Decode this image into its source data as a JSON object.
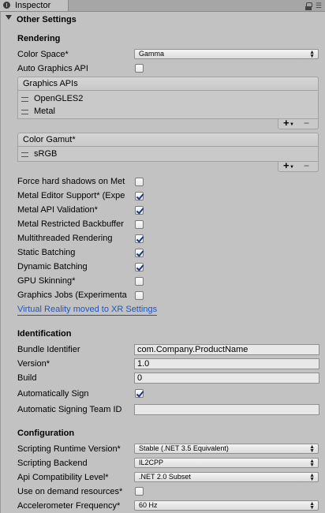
{
  "window": {
    "tab_title": "Inspector",
    "lock_icon": "lock-icon",
    "menu_icon": "menu-icon"
  },
  "foldout": {
    "title": "Other Settings"
  },
  "rendering": {
    "section_title": "Rendering",
    "color_space_label": "Color Space*",
    "color_space_value": "Gamma",
    "auto_graphics_api_label": "Auto Graphics API",
    "auto_graphics_api_checked": false,
    "graphics_apis": {
      "title": "Graphics APIs",
      "items": [
        "OpenGLES2",
        "Metal"
      ],
      "add_label": "+",
      "remove_label": "−"
    },
    "color_gamut": {
      "title": "Color Gamut*",
      "items": [
        "sRGB"
      ],
      "add_label": "+",
      "remove_label": "−"
    },
    "toggles": [
      {
        "label": "Force hard shadows on Met",
        "checked": false
      },
      {
        "label": "Metal Editor Support* (Expe",
        "checked": true
      },
      {
        "label": "Metal API Validation*",
        "checked": true
      },
      {
        "label": "Metal Restricted Backbuffer",
        "checked": false
      },
      {
        "label": "Multithreaded Rendering",
        "checked": true
      },
      {
        "label": "Static Batching",
        "checked": true
      },
      {
        "label": "Dynamic Batching",
        "checked": true
      },
      {
        "label": "GPU Skinning*",
        "checked": false
      },
      {
        "label": "Graphics Jobs (Experimenta",
        "checked": false
      }
    ],
    "vr_link": "Virtual Reality moved to XR Settings"
  },
  "identification": {
    "section_title": "Identification",
    "bundle_identifier_label": "Bundle Identifier",
    "bundle_identifier_value": "com.Company.ProductName",
    "version_label": "Version*",
    "version_value": "1.0",
    "build_label": "Build",
    "build_value": "0",
    "auto_sign_label": "Automatically Sign",
    "auto_sign_checked": true,
    "team_id_label": "Automatic Signing Team ID",
    "team_id_value": ""
  },
  "configuration": {
    "section_title": "Configuration",
    "scripting_runtime_label": "Scripting Runtime Version*",
    "scripting_runtime_value": "Stable (.NET 3.5 Equivalent)",
    "scripting_backend_label": "Scripting Backend",
    "scripting_backend_value": "IL2CPP",
    "api_compat_label": "Api Compatibility Level*",
    "api_compat_value": ".NET 2.0 Subset",
    "on_demand_label": "Use on demand resources*",
    "on_demand_checked": false,
    "accelerometer_label": "Accelerometer Frequency*",
    "accelerometer_value": "60 Hz"
  },
  "colors": {
    "background": "#c2c2c2",
    "link": "#1f55c0",
    "check": "#1c3a78"
  }
}
